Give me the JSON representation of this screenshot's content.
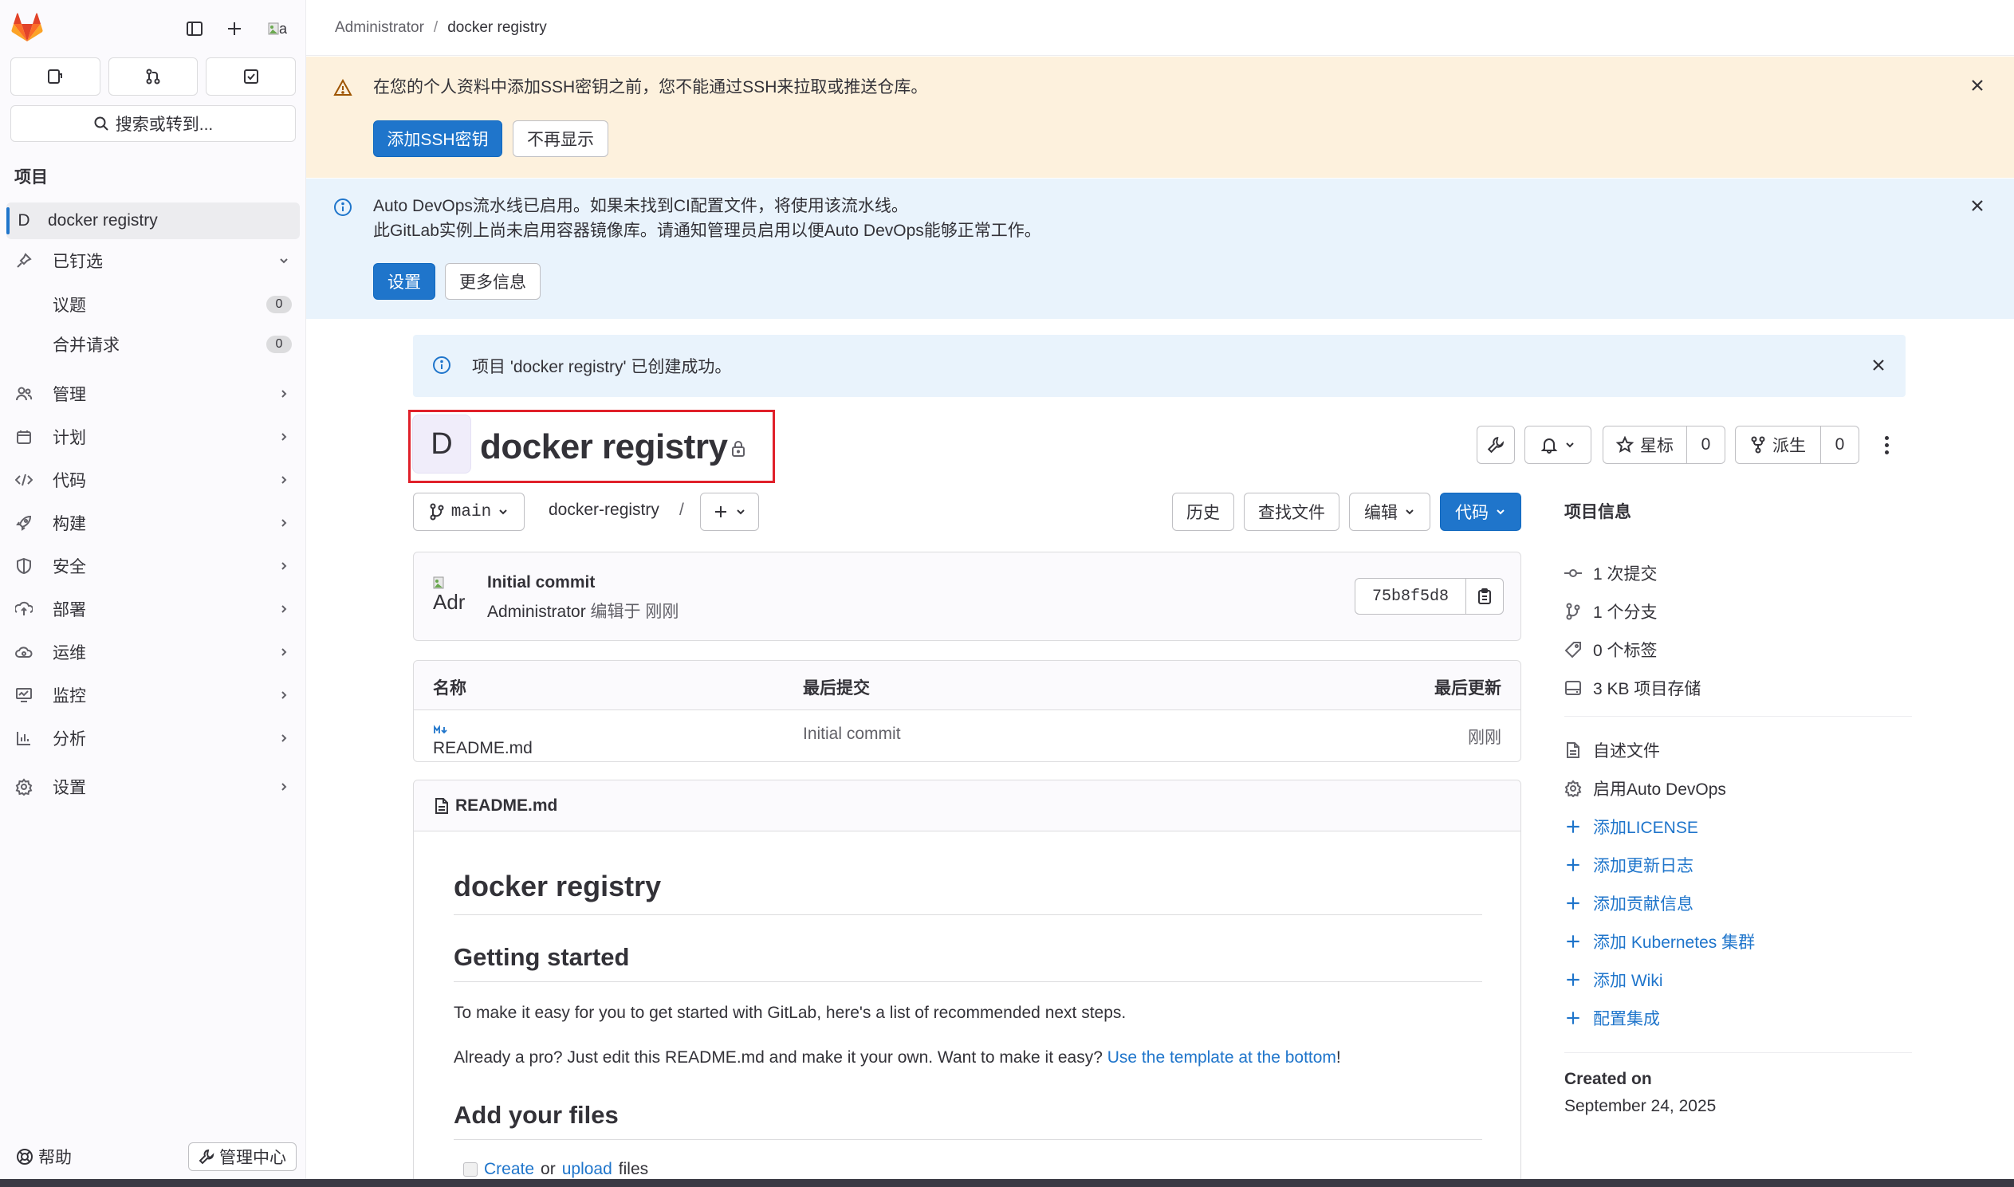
{
  "sidebar": {
    "search_label": "搜索或转到...",
    "section_title": "项目",
    "project_avatar": "D",
    "project_name": "docker registry",
    "pinned_label": "已钉选",
    "pinned_items": [
      {
        "label": "议题",
        "count": "0"
      },
      {
        "label": "合并请求",
        "count": "0"
      }
    ],
    "nav": [
      {
        "label": "管理",
        "icon": "users-icon"
      },
      {
        "label": "计划",
        "icon": "calendar-icon"
      },
      {
        "label": "代码",
        "icon": "code-icon"
      },
      {
        "label": "构建",
        "icon": "rocket-icon"
      },
      {
        "label": "安全",
        "icon": "shield-icon"
      },
      {
        "label": "部署",
        "icon": "deploy-icon"
      },
      {
        "label": "运维",
        "icon": "cloud-icon"
      },
      {
        "label": "监控",
        "icon": "monitor-icon"
      },
      {
        "label": "分析",
        "icon": "chart-icon"
      }
    ],
    "settings_label": "设置",
    "help_label": "帮助",
    "admin_label": "管理中心",
    "user_avatar_alt": "a"
  },
  "breadcrumb": {
    "root": "Administrator",
    "current": "docker registry"
  },
  "ssh_banner": {
    "text": "在您的个人资料中添加SSH密钥之前，您不能通过SSH来拉取或推送仓库。",
    "primary": "添加SSH密钥",
    "secondary": "不再显示"
  },
  "devops_banner": {
    "line1": "Auto DevOps流水线已启用。如果未找到CI配置文件，将使用该流水线。",
    "line2": "此GitLab实例上尚未启用容器镜像库。请通知管理员启用以便Auto DevOps能够正常工作。",
    "primary": "设置",
    "secondary": "更多信息"
  },
  "created_alert": "项目 'docker registry' 已创建成功。",
  "project": {
    "avatar": "D",
    "title": "docker registry",
    "star_label": "星标",
    "star_count": "0",
    "fork_label": "派生",
    "fork_count": "0"
  },
  "repo": {
    "branch": "main",
    "path": "docker-registry",
    "path_sep": "/",
    "history": "历史",
    "find_file": "查找文件",
    "edit": "编辑",
    "code": "代码"
  },
  "commit": {
    "avatar_alt": "Adr",
    "title": "Initial commit",
    "author": "Administrator",
    "meta": "编辑于 刚刚",
    "sha": "75b8f5d8"
  },
  "files": {
    "headers": [
      "名称",
      "最后提交",
      "最后更新"
    ],
    "rows": [
      {
        "name": "README.md",
        "commit": "Initial commit",
        "updated": "刚刚"
      }
    ]
  },
  "readme": {
    "filename": "README.md",
    "h1": "docker registry",
    "h2_started": "Getting started",
    "p1": "To make it easy for you to get started with GitLab, here's a list of recommended next steps.",
    "p2_text": "Already a pro? Just edit this README.md and make it your own. Want to make it easy?",
    "p2_link": "Use the template at the bottom",
    "p2_end": "!",
    "h2_files": "Add your files",
    "li_create": "Create",
    "li_or": "or",
    "li_upload": "upload",
    "li_files": "files"
  },
  "info": {
    "title": "项目信息",
    "stats": [
      "1 次提交",
      "1 个分支",
      "0 个标签",
      "3 KB 项目存储"
    ],
    "readme": "自述文件",
    "autodevops": "启用Auto DevOps",
    "add_links": [
      "添加LICENSE",
      "添加更新日志",
      "添加贡献信息",
      "添加 Kubernetes 集群",
      "添加 Wiki",
      "配置集成"
    ],
    "created_label": "Created on",
    "created_date": "September 24, 2025"
  },
  "colors": {
    "primary": "#1f75cb",
    "warning_bg": "#fdf1dd",
    "info_bg": "#e9f3fc",
    "highlight": "#e0202a"
  }
}
